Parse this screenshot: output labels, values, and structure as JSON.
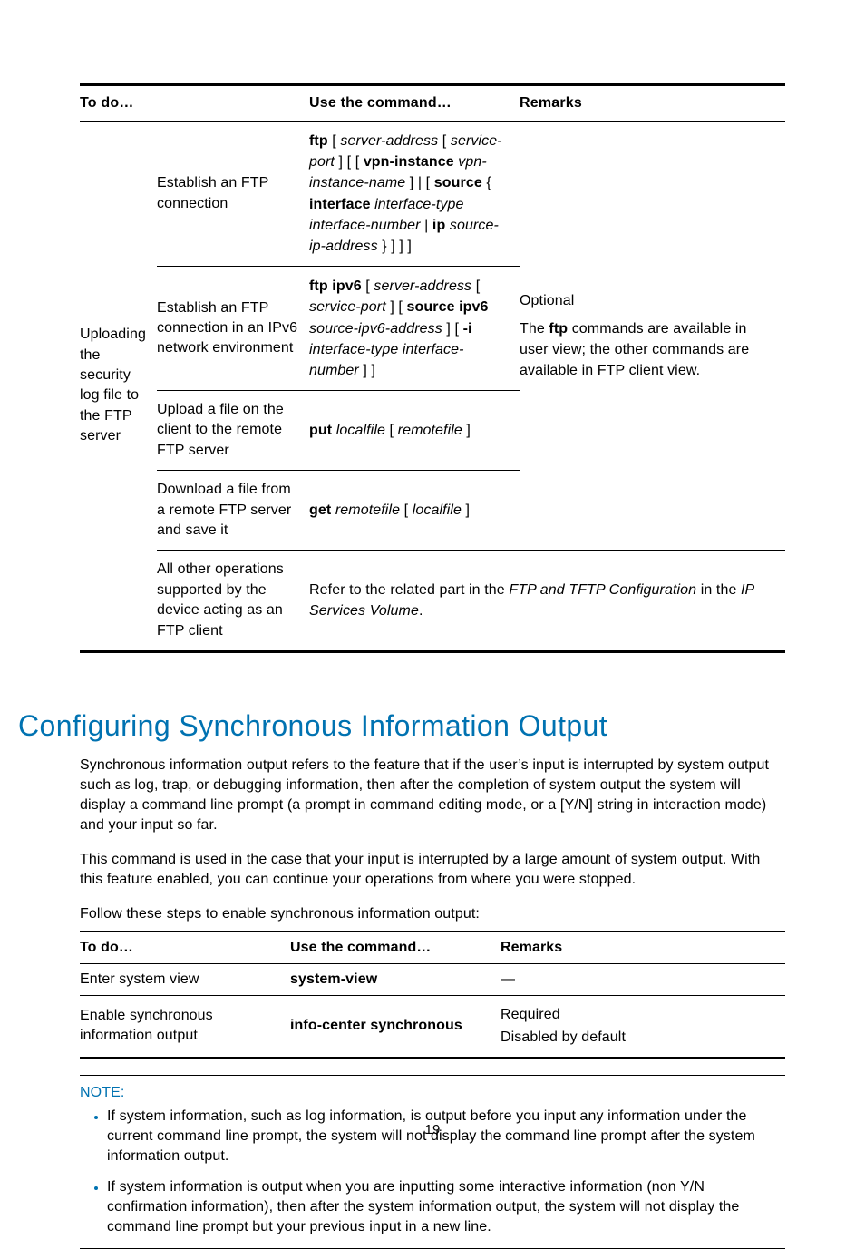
{
  "table1": {
    "headers": {
      "todo": "To do…",
      "cmd": "Use the command…",
      "remarks": "Remarks"
    },
    "groupLabel": "Uploading the security log file to the FTP server",
    "rows": [
      {
        "action": "Establish an FTP connection",
        "cmd_html": "<span class='b'>ftp</span> [ <span class='i'>server-address</span> [ <span class='i'>service-port</span> ] [ [ <span class='b'>vpn-instance</span> <span class='i'>vpn-instance-name</span> ] | [ <span class='b'>source</span> { <span class='b'>interface</span> <span class='i'>interface-type interface-number</span> | <span class='b'>ip</span> <span class='i'>source-ip-address</span> } ] ] ]"
      },
      {
        "action": "Establish an FTP connection in an IPv6 network environment",
        "cmd_html": "<span class='b'>ftp ipv6</span> [ <span class='i'>server-address</span> [ <span class='i'>service-port</span> ] [ <span class='b'>source ipv6</span> <span class='i'>source-ipv6-address</span> ] [ <span class='b'>-i</span> <span class='i'>interface-type interface-number</span> ] ]"
      },
      {
        "action": "Upload a file on the client to the remote FTP server",
        "cmd_html": "<span class='b'>put</span> <span class='i'>localfile</span> [ <span class='i'>remotefile</span> ]"
      },
      {
        "action": "Download a file from a remote FTP server and save it",
        "cmd_html": "<span class='b'>get</span> <span class='i'>remotefile</span> [ <span class='i'>localfile</span> ]"
      },
      {
        "action": "All other operations supported by the device acting as an FTP client",
        "cmd_html": "Refer to the related part in the <span class='i'>FTP and TFTP Configuration</span> in the <span class='i'>IP Services Volume</span>."
      }
    ],
    "remarks_html": "<p>Optional</p><p>The <span class='b'>ftp</span> commands are available in user view; the other commands are available in FTP client view.</p>"
  },
  "heading": "Configuring Synchronous Information Output",
  "para1": "Synchronous information output refers to the feature that if the user’s input is interrupted by system output such as log, trap, or debugging information, then after the completion of system output the system will display a command line prompt (a prompt in command editing mode, or a [Y/N] string in interaction mode) and your input so far.",
  "para2": "This command is used in the case that your input is interrupted by a large amount of system output. With this feature enabled, you can continue your operations from where you were stopped.",
  "para3": "Follow these steps to enable synchronous information output:",
  "table2": {
    "headers": {
      "todo": "To do…",
      "cmd": "Use the command…",
      "remarks": "Remarks"
    },
    "rows": [
      {
        "todo": "Enter system view",
        "cmd": "system-view",
        "remarks": "—"
      },
      {
        "todo": "Enable synchronous information output",
        "cmd": "info-center synchronous",
        "remarks_html": "Required<br>Disabled by default"
      }
    ]
  },
  "note": {
    "label": "NOTE:",
    "items": [
      "If system information, such as log information, is output before you input any information under the current command line prompt, the system will not display the command line prompt after the system information output.",
      "If system information is output when you are inputting some interactive information (non Y/N confirmation information), then after the system information output, the system will not display the command line prompt but your previous input in a new line."
    ]
  },
  "pageNumber": "19"
}
